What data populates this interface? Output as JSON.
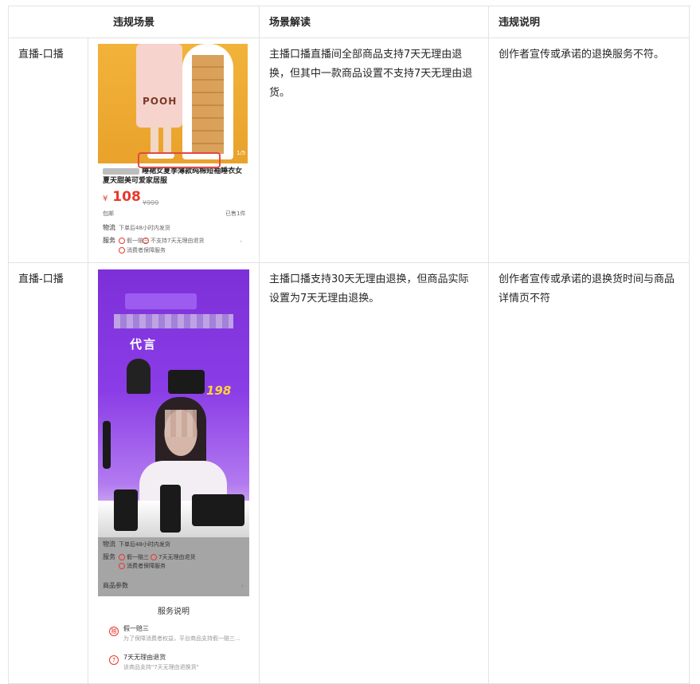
{
  "headers": [
    "违规场景",
    "场景解读",
    "违规说明"
  ],
  "rows": [
    {
      "type": "直播-口播",
      "interpretation": "主播口播直播间全部商品支持7天无理由退换，但其中一款商品设置不支持7天无理由退货。",
      "explanation": "创作者宣传或承诺的退换服务不符。",
      "screenshot": {
        "print_text": "POOH",
        "title_visible": "睡裙女夏季薄款纯棉短袖睡衣女夏天甜美可爱家居服",
        "currency": "¥",
        "price": "108",
        "old_price": "¥999",
        "shipping": "包邮",
        "sold": "已售1件",
        "page": "1/5",
        "logistics_label": "物流",
        "logistics_value": "下单后48小时内发货",
        "service_label": "服务",
        "service_item1": "假一赔三",
        "service_item2": "不支持7天无理由退货",
        "service_item3": "消费者保障服务"
      }
    },
    {
      "type": "直播-口播",
      "interpretation": "主播口播支持30天无理由退换，但商品实际设置为7天无理由退换。",
      "explanation": "创作者宣传或承诺的退换货时间与商品详情页不符",
      "screenshot": {
        "title_fragment": "代言",
        "price_fragment": "198",
        "logistics_label": "物流",
        "logistics_value": "下单后48小时内发货",
        "service_label": "服务",
        "service_item1": "假一赔三",
        "service_item2": "7天无理由退货",
        "service_item3": "消费者保障服务",
        "params_label": "商品参数",
        "sheet_title": "服务说明",
        "sheet_item1_title": "假一赔三",
        "sheet_item1_desc": "为了保障消费者权益，平台商品支持假一赔三...",
        "sheet_item2_title": "7天无理由退货",
        "sheet_item2_desc": "该商品支持\"7天无理由退换货\""
      }
    }
  ],
  "colors": {
    "border": "#e3e3e3",
    "price_red": "#e8382b",
    "purple": "#8a3ce6",
    "orange": "#f2b33a"
  }
}
